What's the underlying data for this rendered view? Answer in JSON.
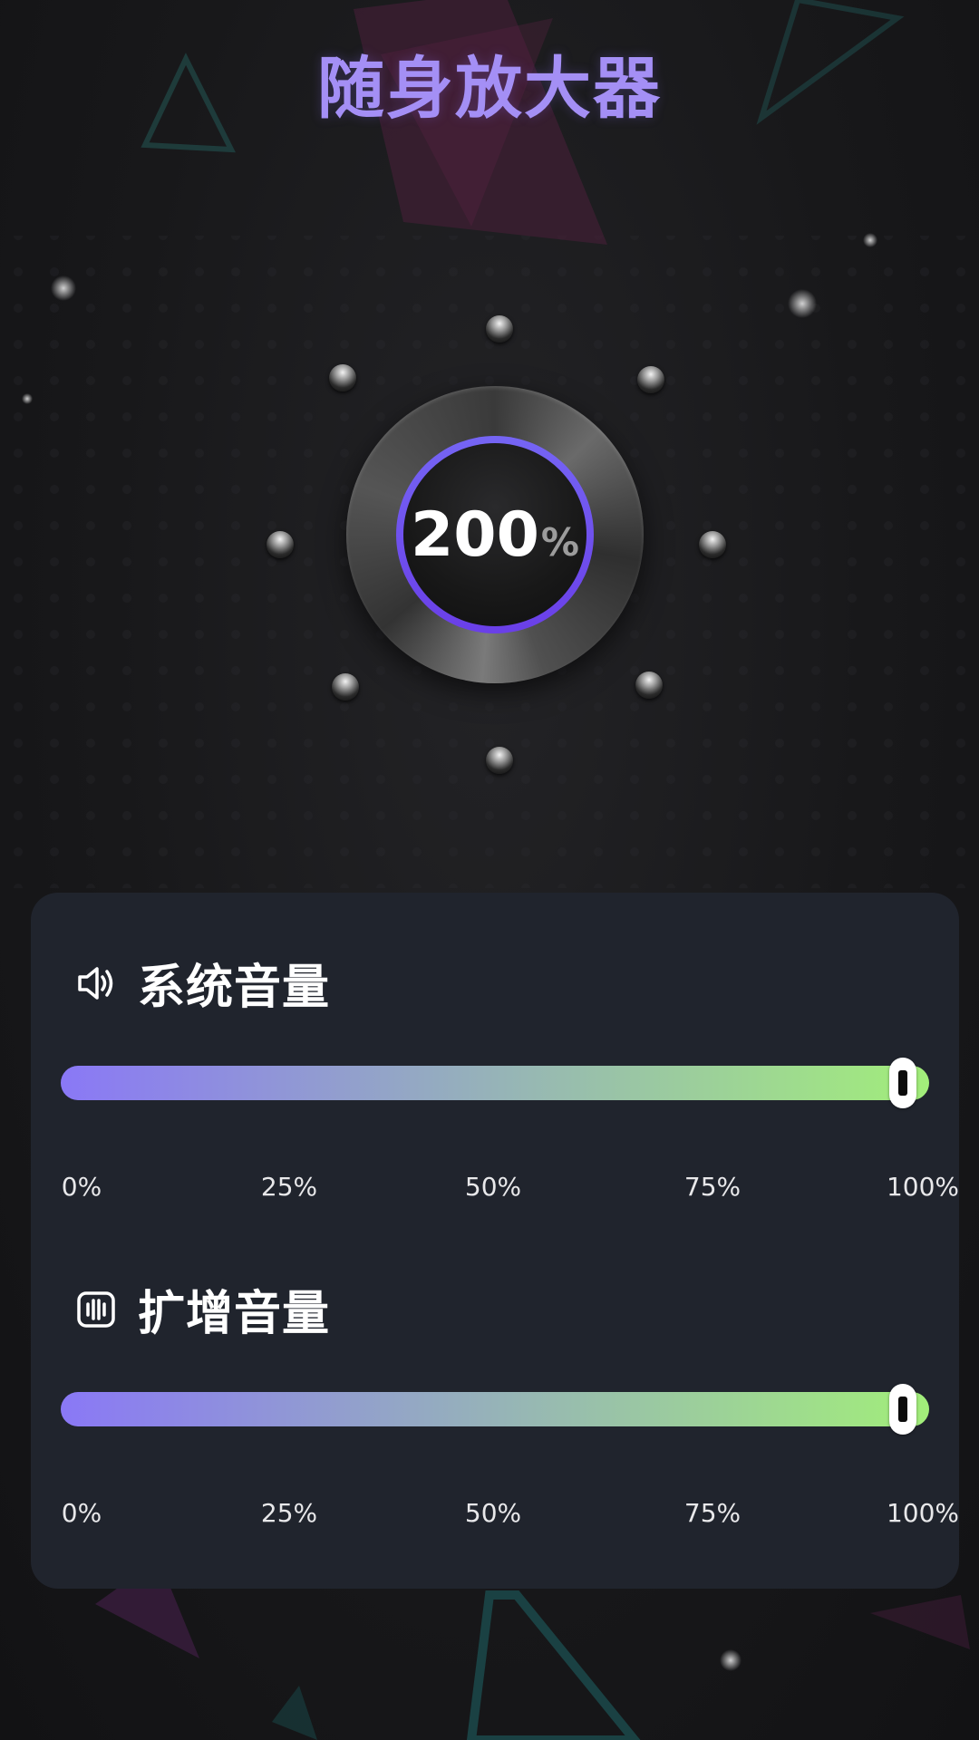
{
  "app": {
    "title": "随身放大器"
  },
  "amplifier": {
    "value": "200",
    "unit": "%"
  },
  "system_volume": {
    "label": "系统音量",
    "icon": "speaker-icon",
    "level": 0.97,
    "ticks": [
      "0%",
      "25%",
      "50%",
      "75%",
      "100%"
    ]
  },
  "boost_volume": {
    "label": "扩增音量",
    "icon": "sound-wave-icon",
    "level": 0.97,
    "ticks": [
      "0%",
      "25%",
      "50%",
      "75%",
      "100%"
    ]
  },
  "colors": {
    "title": "#a48ff5",
    "slider_start": "#8a78f6",
    "slider_end": "#a2ee7a",
    "ring": "#6f52ee",
    "panel": "#20242d"
  }
}
